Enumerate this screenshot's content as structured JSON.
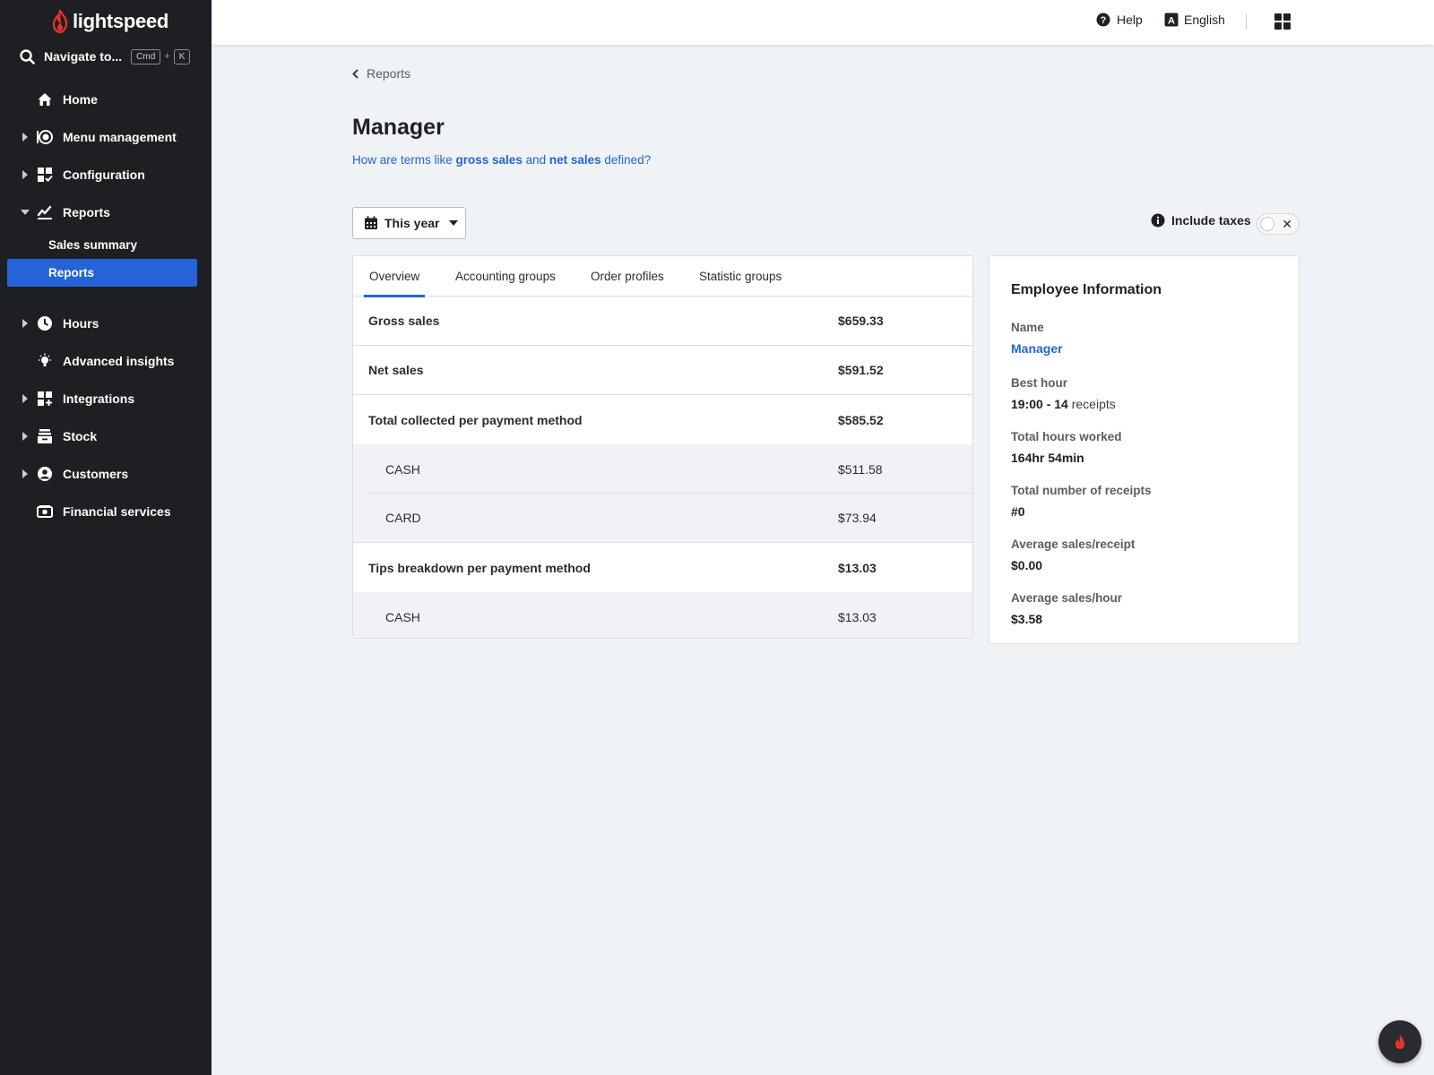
{
  "app": {
    "brand": "lightspeed"
  },
  "navigate": {
    "label": "Navigate to...",
    "key1": "Cmd",
    "plus": "+",
    "key2": "K"
  },
  "sidebar": {
    "items": [
      {
        "label": "Home",
        "icon": "home-icon"
      },
      {
        "label": "Menu management",
        "icon": "menu-management-icon"
      },
      {
        "label": "Configuration",
        "icon": "configuration-icon"
      },
      {
        "label": "Reports",
        "icon": "reports-icon"
      },
      {
        "label": "Hours",
        "icon": "clock-icon"
      },
      {
        "label": "Advanced insights",
        "icon": "lightbulb-icon"
      },
      {
        "label": "Integrations",
        "icon": "integrations-icon"
      },
      {
        "label": "Stock",
        "icon": "stock-icon"
      },
      {
        "label": "Customers",
        "icon": "customers-icon"
      },
      {
        "label": "Financial services",
        "icon": "financial-services-icon"
      }
    ],
    "sub_items": [
      {
        "label": "Sales summary"
      },
      {
        "label": "Reports"
      }
    ]
  },
  "topbar": {
    "help": "Help",
    "language": "English"
  },
  "breadcrumb": {
    "label": "Reports"
  },
  "page": {
    "title": "Manager",
    "help_prefix": "How are terms like ",
    "help_term1": "gross sales",
    "help_mid": " and ",
    "help_term2": "net sales",
    "help_suffix": " defined?"
  },
  "date_filter": {
    "label": "This year"
  },
  "taxes": {
    "label": "Include taxes",
    "enabled": false
  },
  "tabs": [
    {
      "label": "Overview",
      "active": true
    },
    {
      "label": "Accounting groups",
      "active": false
    },
    {
      "label": "Order profiles",
      "active": false
    },
    {
      "label": "Statistic groups",
      "active": false
    }
  ],
  "report_rows": [
    {
      "label": "Gross sales",
      "value": "$659.33"
    },
    {
      "label": "Net sales",
      "value": "$591.52"
    },
    {
      "label": "Total collected per payment method",
      "value": "$585.52"
    },
    {
      "label": "CASH",
      "value": "$511.58"
    },
    {
      "label": "CARD",
      "value": "$73.94"
    },
    {
      "label": "Tips breakdown per payment method",
      "value": "$13.03"
    },
    {
      "label": "CASH",
      "value": "$13.03"
    }
  ],
  "employee": {
    "title": "Employee Information",
    "name_label": "Name",
    "name_value": "Manager",
    "best_hour_label": "Best hour",
    "best_hour_time": "19:00",
    "best_hour_sep": " - ",
    "best_hour_count": "14",
    "best_hour_unit": " receipts",
    "hours_label": "Total hours worked",
    "hours_value": "164hr 54min",
    "receipts_label": "Total number of receipts",
    "receipts_value": "#0",
    "avg_receipt_label": "Average sales/receipt",
    "avg_receipt_value": "$0.00",
    "avg_hour_label": "Average sales/hour",
    "avg_hour_value": "$3.58"
  },
  "colors": {
    "sidebar_bg": "#1e1f23",
    "accent": "#2563d9",
    "brand_red": "#e8332d",
    "page_bg": "#f0f3f6"
  }
}
